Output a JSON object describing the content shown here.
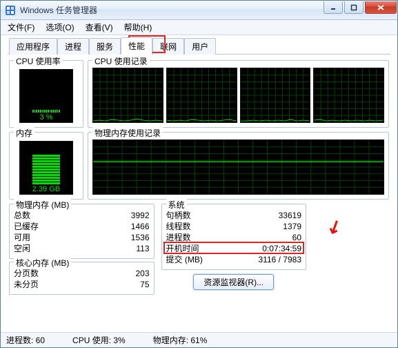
{
  "title": "Windows 任务管理器",
  "menu": {
    "file": "文件(F)",
    "options": "选项(O)",
    "view": "查看(V)",
    "help": "帮助(H)"
  },
  "tabs": {
    "apps": "应用程序",
    "processes": "进程",
    "services": "服务",
    "performance": "性能",
    "networking": "联网",
    "users": "用户"
  },
  "labels": {
    "cpu_usage": "CPU 使用率",
    "cpu_history": "CPU 使用记录",
    "mem_usage": "内存",
    "mem_history": "物理内存使用记录",
    "phys_mem_mb": "物理内存 (MB)",
    "total": "总数",
    "cached": "已缓存",
    "available": "可用",
    "free": "空闲",
    "kernel_mem_mb": "核心内存 (MB)",
    "paged": "分页数",
    "nonpaged": "未分页",
    "system": "系统",
    "handles": "句柄数",
    "threads": "线程数",
    "processes": "进程数",
    "uptime": "开机时间",
    "commit": "提交 (MB)"
  },
  "values": {
    "cpu_pct": "3 %",
    "mem_gb": "2.39 GB",
    "total": "3992",
    "cached": "1466",
    "available": "1536",
    "free": "113",
    "paged": "203",
    "nonpaged": "75",
    "handles": "33619",
    "threads": "1379",
    "processes": "60",
    "uptime": "0:07:34:59",
    "commit": "3116 / 7983"
  },
  "res_btn": "资源监视器(R)...",
  "status": {
    "processes": "进程数: 60",
    "cpu": "CPU 使用: 3%",
    "mem": "物理内存: 61%"
  },
  "chart_data": {
    "type": "line",
    "series": [
      {
        "name": "cpu0",
        "values": [
          2,
          3,
          2,
          4,
          3,
          2,
          3,
          5,
          3,
          2,
          3,
          2
        ]
      },
      {
        "name": "cpu1",
        "values": [
          3,
          2,
          3,
          2,
          4,
          3,
          2,
          3,
          2,
          3,
          4,
          2
        ]
      },
      {
        "name": "cpu2",
        "values": [
          2,
          2,
          3,
          2,
          3,
          2,
          3,
          2,
          4,
          2,
          3,
          2
        ]
      },
      {
        "name": "cpu3",
        "values": [
          3,
          4,
          2,
          3,
          2,
          3,
          2,
          3,
          2,
          3,
          2,
          3
        ]
      }
    ],
    "x": [
      0,
      1,
      2,
      3,
      4,
      5,
      6,
      7,
      8,
      9,
      10,
      11
    ],
    "ylim": [
      0,
      100
    ]
  }
}
